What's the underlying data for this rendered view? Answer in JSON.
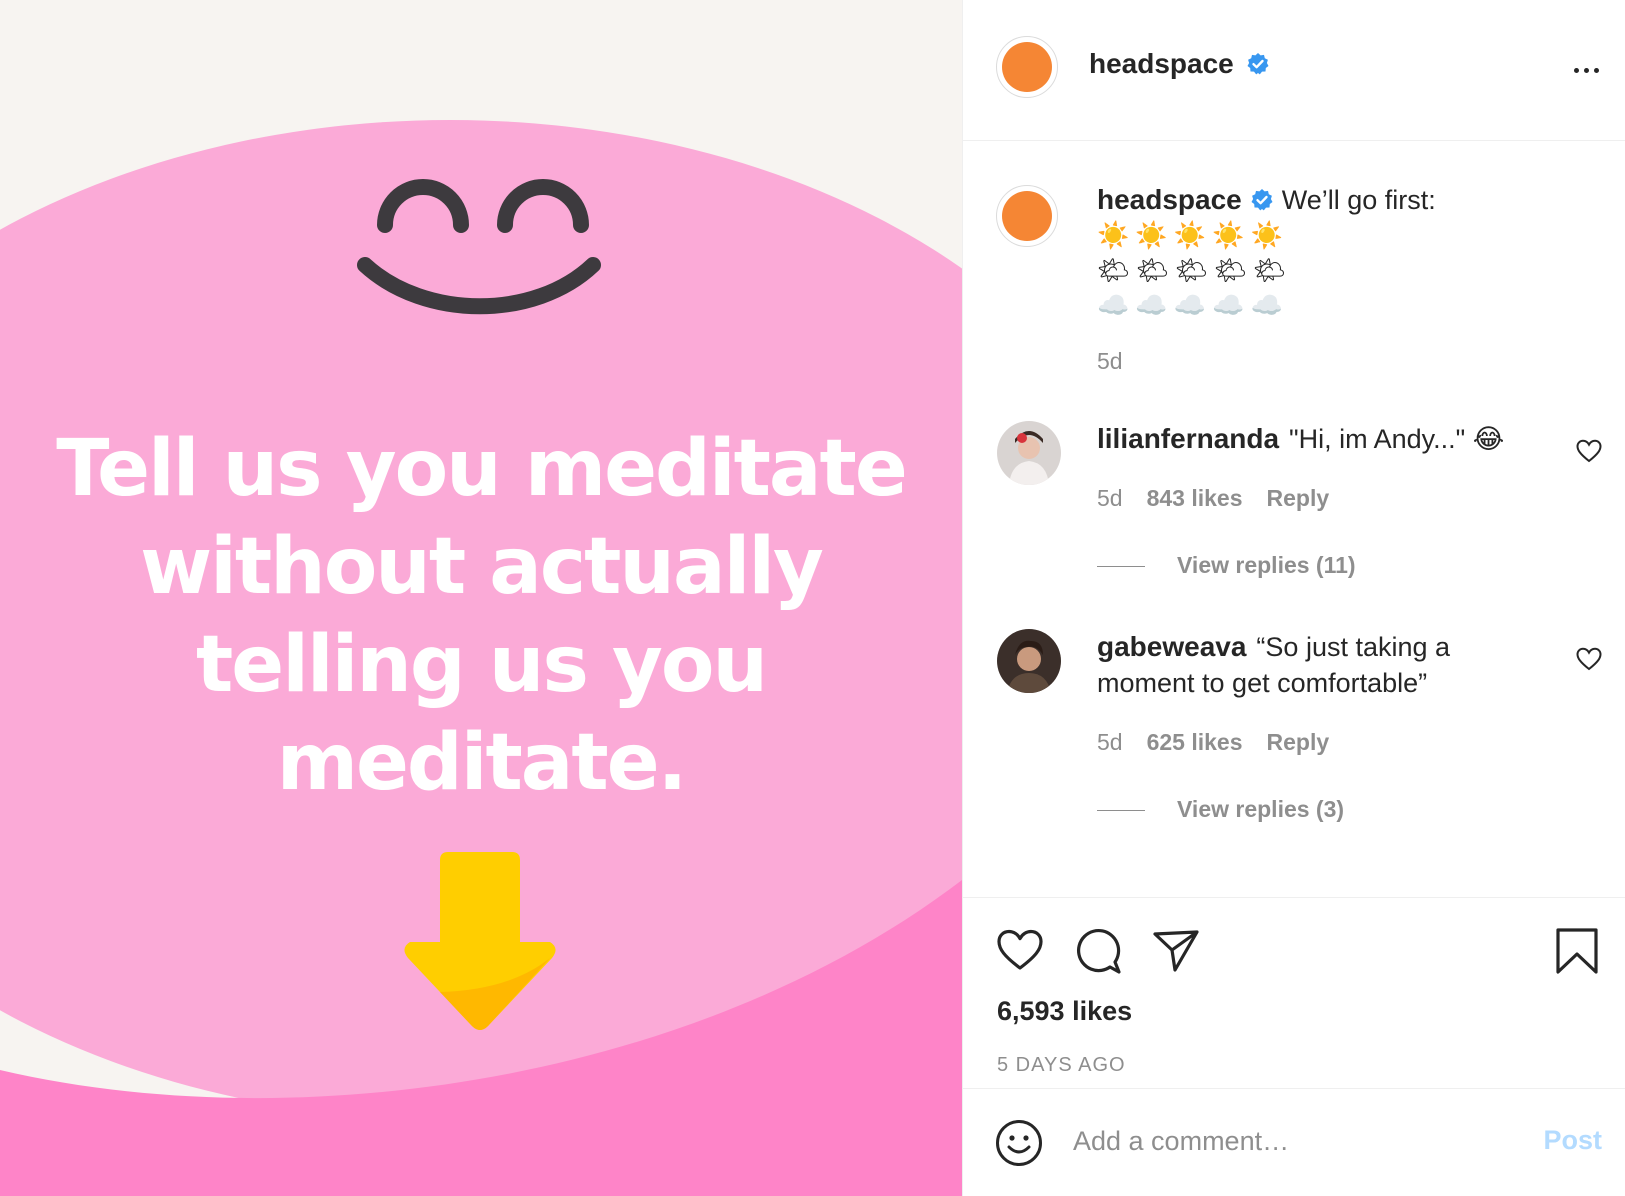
{
  "post_image": {
    "headline": [
      "Tell us you meditate",
      "without actually",
      "telling us you",
      "meditate."
    ],
    "colors": {
      "background": "#f7f4f1",
      "pink_light": "#fbaad7",
      "pink_dark": "#fe84c8",
      "arrow": "#ffce00",
      "arrow_shadow": "#ffb800",
      "face": "#3d3a3e"
    }
  },
  "header": {
    "username": "headspace",
    "verified": true,
    "avatar_color": "#f58634"
  },
  "caption": {
    "username": "headspace",
    "text": "We’ll go first:",
    "rows": [
      "☀️☀️☀️☀️☀️",
      "🌤🌤🌤🌤🌤",
      "☁️☁️☁️☁️☁️"
    ],
    "time": "5d"
  },
  "comments": [
    {
      "username": "lilianfernanda",
      "text": "\"Hi, im Andy...\" 😂",
      "time": "5d",
      "likes": "843 likes",
      "reply": "Reply",
      "view_replies": "View replies (11)"
    },
    {
      "username": "gabeweava",
      "text": "“So just taking a moment to get comfortable”",
      "time": "5d",
      "likes": "625 likes",
      "reply": "Reply",
      "view_replies": "View replies (3)"
    }
  ],
  "actions": {
    "icons": [
      "heart-icon",
      "comment-icon",
      "share-icon",
      "bookmark-icon"
    ],
    "likes": "6,593 likes",
    "date": "5 DAYS AGO"
  },
  "add_comment": {
    "placeholder": "Add a comment…",
    "post_label": "Post",
    "accent_color": "#0095f6"
  }
}
